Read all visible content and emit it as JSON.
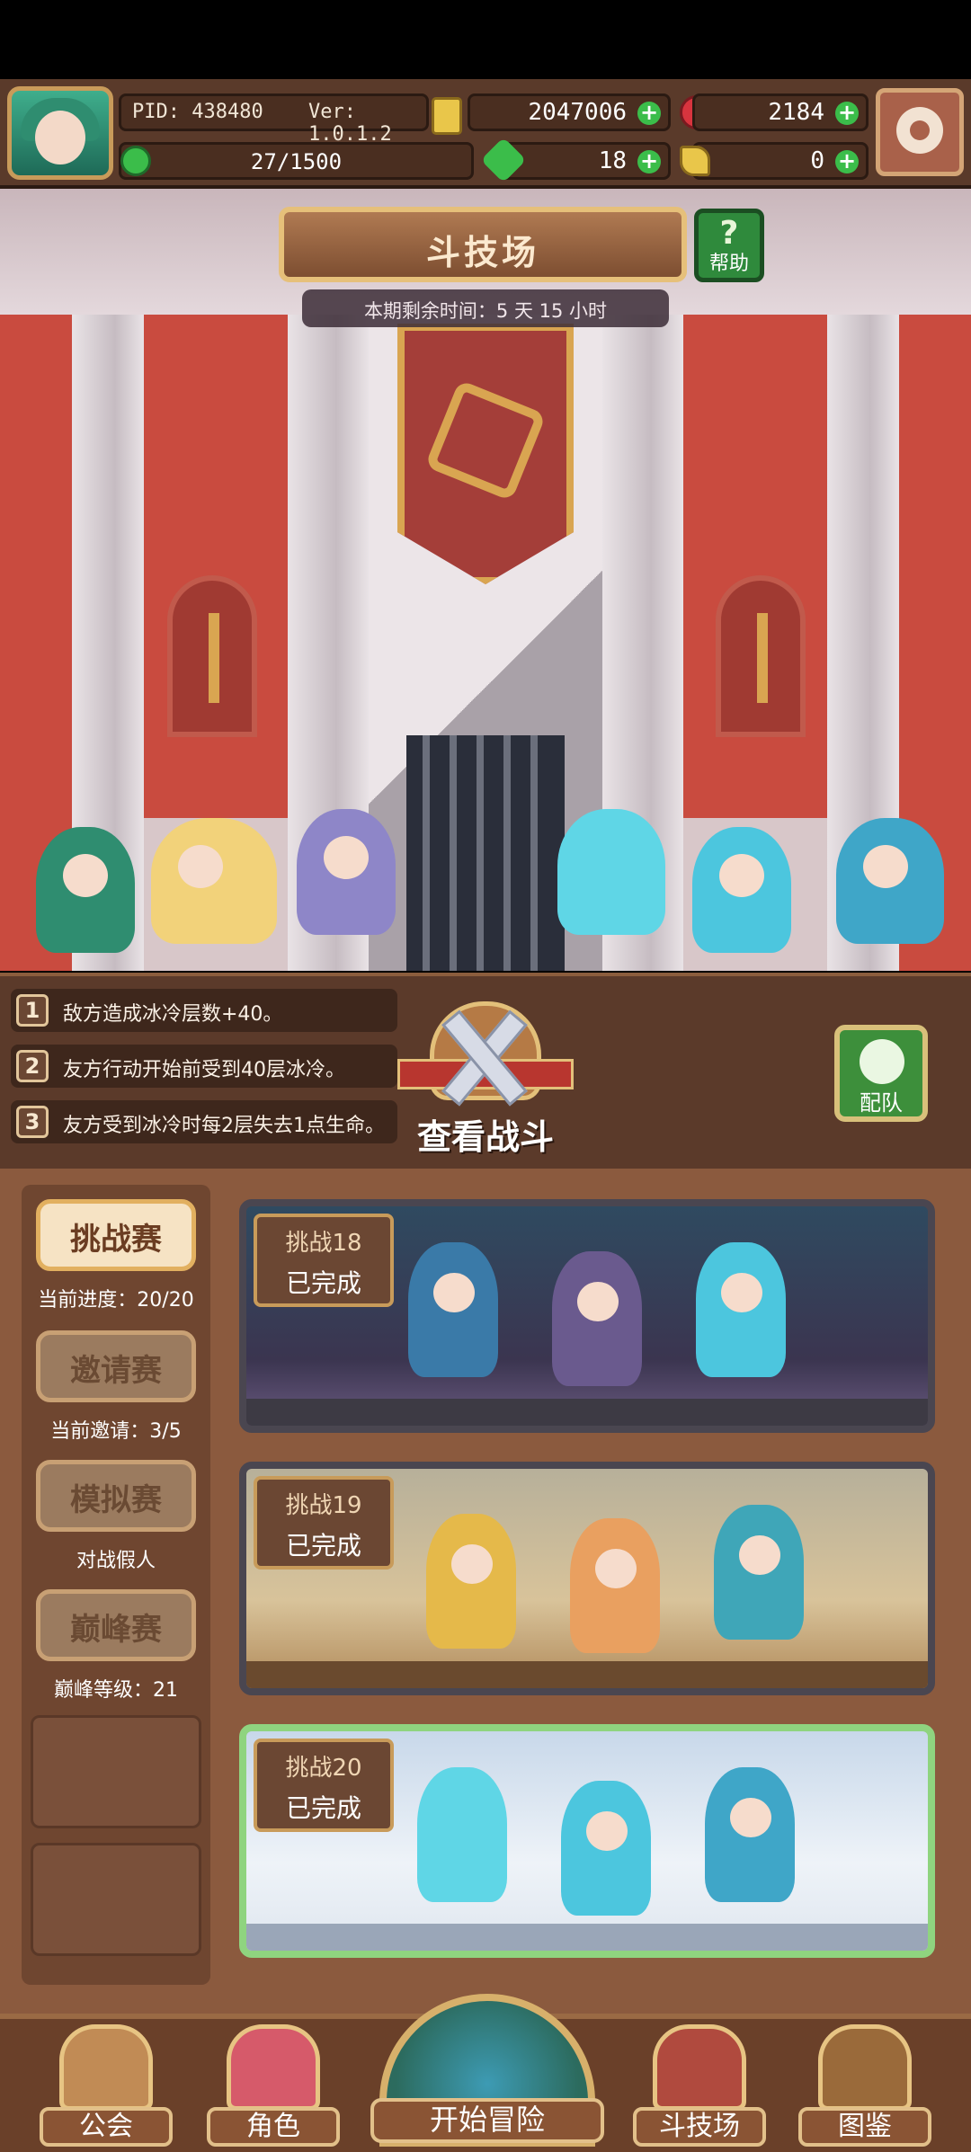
{
  "hud": {
    "pid": "PID: 438480",
    "version": "Ver: 1.0.1.2",
    "gold": "2047006",
    "gems": "2184",
    "level_progress": "27/1500",
    "clover": "18",
    "key": "0"
  },
  "arena": {
    "title": "斗技场",
    "help_label": "帮助",
    "help_symbol": "?",
    "time_remaining": "本期剩余时间：5 天 15 小时"
  },
  "effects": [
    {
      "num": "1",
      "text": "敌方造成冰冷层数+40。"
    },
    {
      "num": "2",
      "text": "友方行动开始前受到40层冰冷。"
    },
    {
      "num": "3",
      "text": "友方受到冰冷时每2层失去1点生命。"
    }
  ],
  "actions": {
    "view_battle": "查看战斗",
    "team_setup": "配队"
  },
  "modes": [
    {
      "label": "挑战赛",
      "sub": "当前进度：20/20",
      "active": true
    },
    {
      "label": "邀请赛",
      "sub": "当前邀请：3/5",
      "active": false
    },
    {
      "label": "模拟赛",
      "sub": "对战假人",
      "active": false
    },
    {
      "label": "巅峰赛",
      "sub": "巅峰等级：21",
      "active": false
    }
  ],
  "challenges": [
    {
      "title": "挑战18",
      "status": "已完成"
    },
    {
      "title": "挑战19",
      "status": "已完成"
    },
    {
      "title": "挑战20",
      "status": "已完成"
    }
  ],
  "nav": {
    "guild": "公会",
    "character": "角色",
    "adventure": "开始冒险",
    "arena": "斗技场",
    "codex": "图鉴"
  },
  "colors": {
    "accent_green": "#3bbd4a",
    "panel_brown": "#8b5a3e",
    "selected_border": "#8fd47f"
  }
}
